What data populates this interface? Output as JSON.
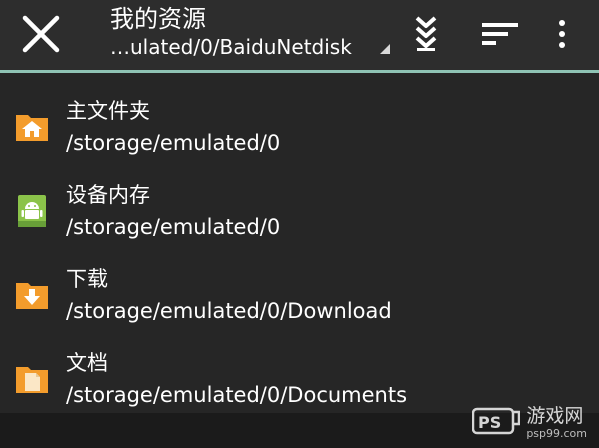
{
  "toolbar": {
    "title": "我的资源",
    "current_path": "…ulated/0/BaiduNetdisk",
    "icons": {
      "close": "close-icon",
      "download_sort": "download-arrows-icon",
      "sort": "sort-lines-icon",
      "more": "more-vert-icon"
    },
    "accent_color": "#8fc3b4"
  },
  "locations": [
    {
      "name": "主文件夹",
      "path": "/storage/emulated/0",
      "icon": "home-folder-icon",
      "color": "#f39c2c"
    },
    {
      "name": "设备内存",
      "path": "/storage/emulated/0",
      "icon": "android-storage-icon",
      "color": "#8bc34a"
    },
    {
      "name": "下载",
      "path": "/storage/emulated/0/Download",
      "icon": "download-folder-icon",
      "color": "#f39c2c"
    },
    {
      "name": "文档",
      "path": "/storage/emulated/0/Documents",
      "icon": "documents-folder-icon",
      "color": "#f39c2c"
    }
  ],
  "watermark": {
    "logo_text": "PSP",
    "name": "游戏网",
    "url": "psp99.com"
  }
}
